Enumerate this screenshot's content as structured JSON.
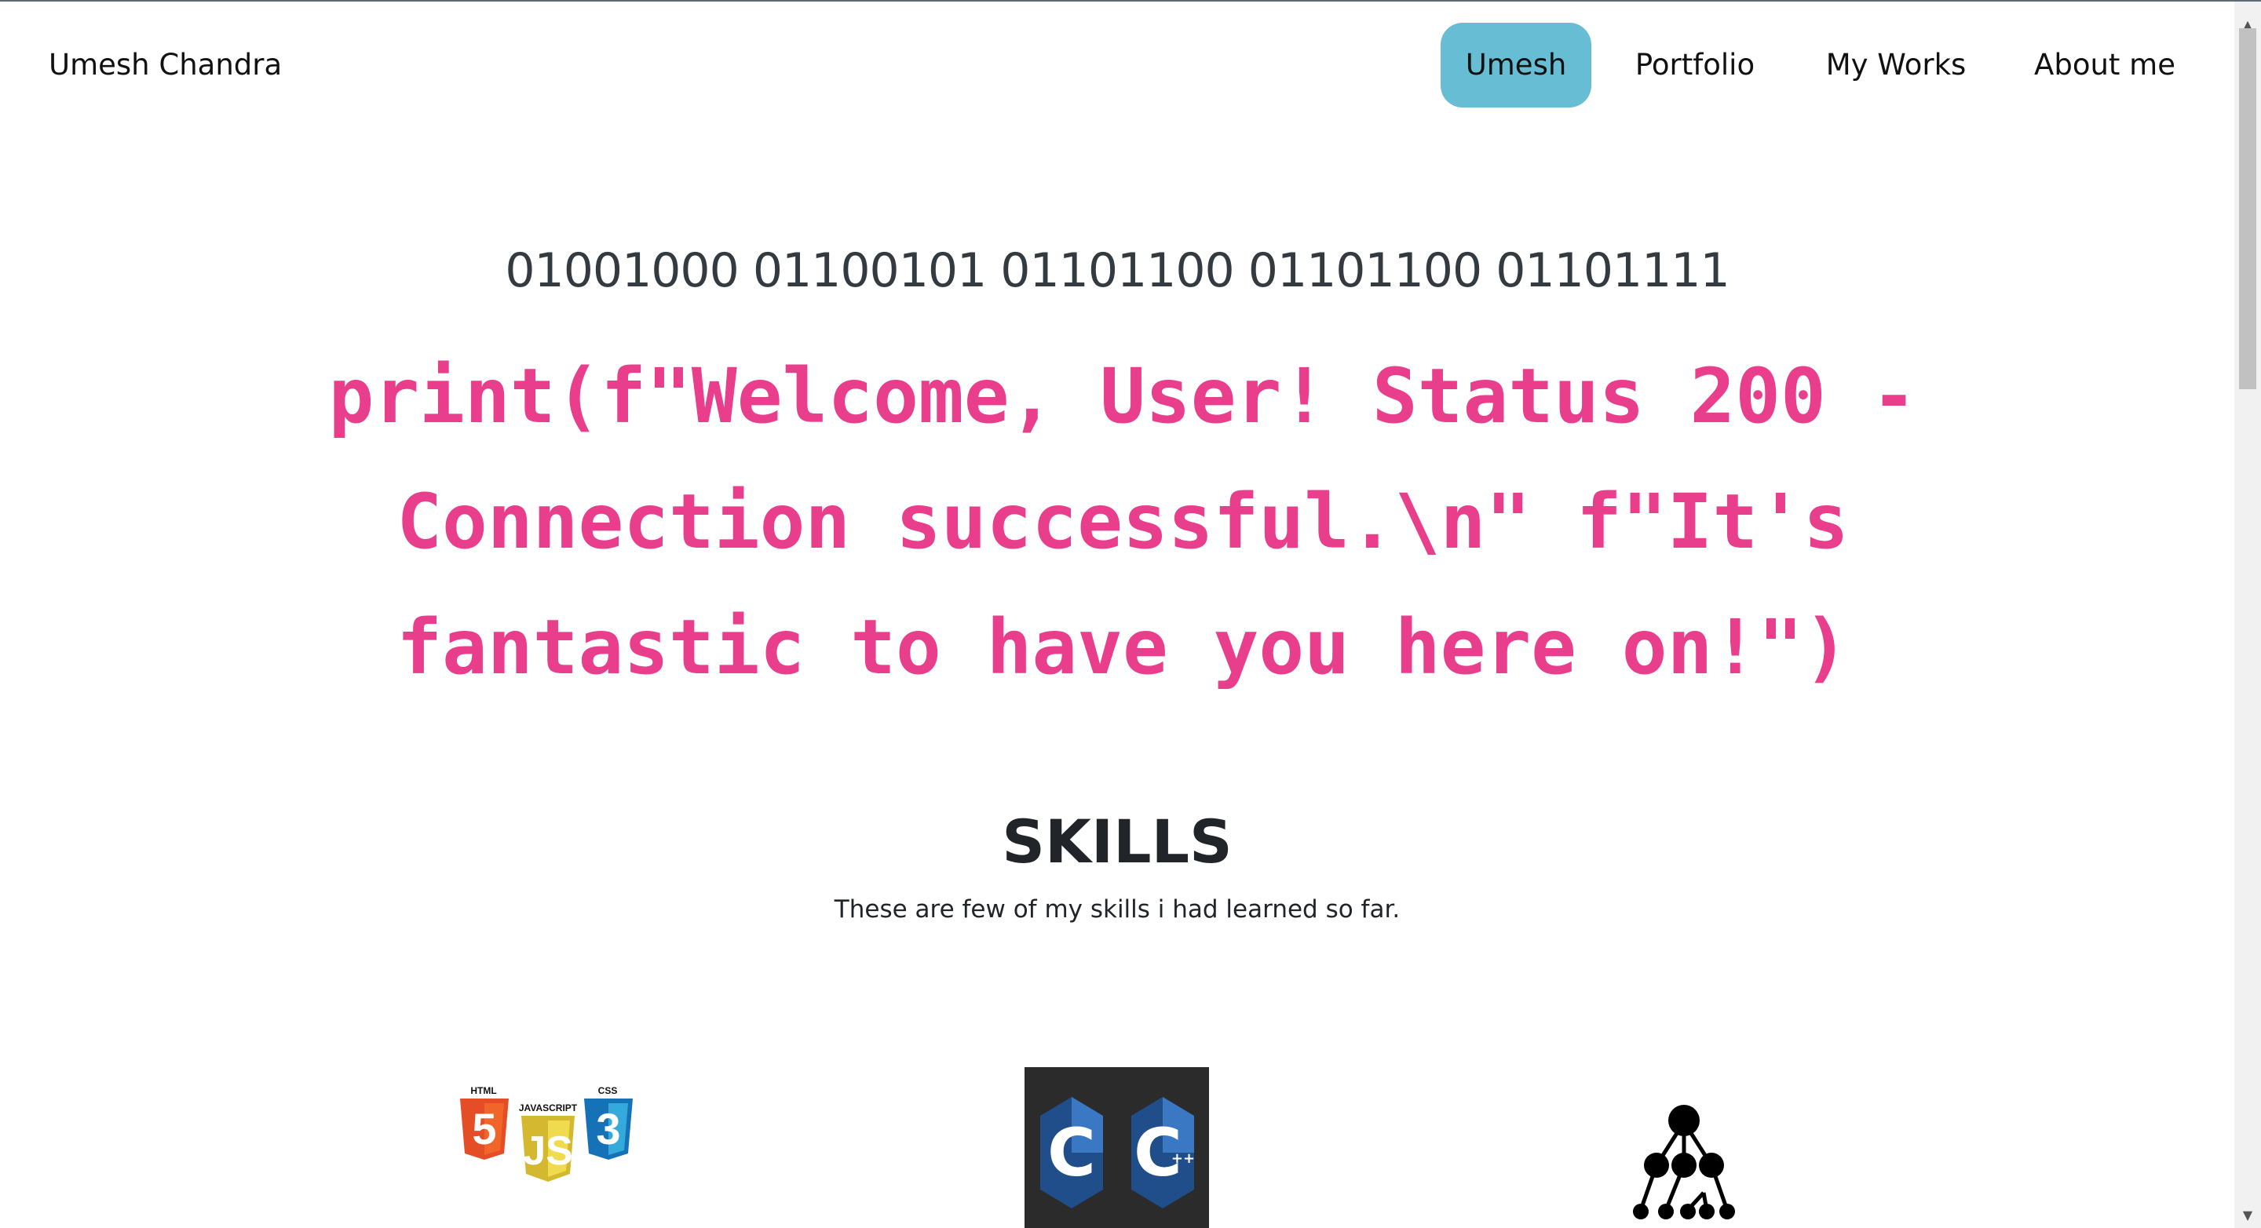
{
  "navbar": {
    "brand": "Umesh Chandra",
    "items": [
      {
        "label": "Umesh",
        "active": true
      },
      {
        "label": "Portfolio",
        "active": false
      },
      {
        "label": "My Works",
        "active": false
      },
      {
        "label": "About me",
        "active": false
      }
    ],
    "active_color": "#66bdd4"
  },
  "hero": {
    "binary": "01001000 01100101 01101100 01101100 01101111",
    "code_line": "print(f\"Welcome, User! Status 200 - Connection successful.\\n\" f\"It's fantastic to have you here on!\")",
    "code_color": "#e83e8c"
  },
  "skills": {
    "title": "SKILLS",
    "subtitle": "These are few of my skills i had learned so far.",
    "items": [
      {
        "icon": "html-js-css-icon",
        "logo_text": [
          "HTML",
          "JAVASCRIPT",
          "CSS"
        ]
      },
      {
        "icon": "c-cpp-icon",
        "logo_text": [
          "C",
          "C",
          "++"
        ]
      },
      {
        "icon": "data-structures-tree-icon"
      }
    ]
  }
}
